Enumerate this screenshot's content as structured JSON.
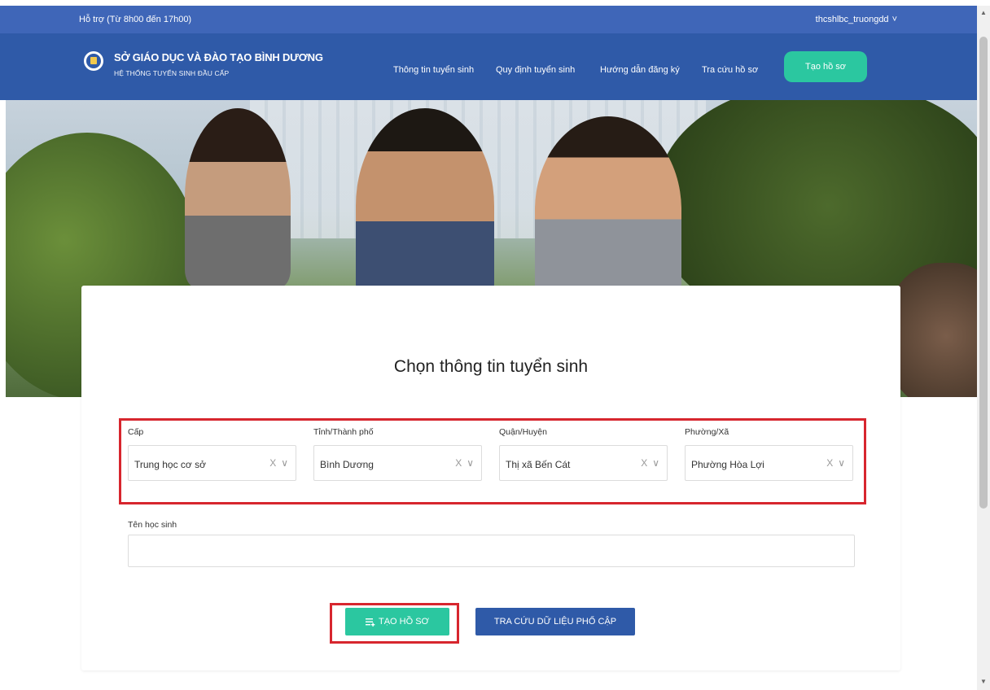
{
  "topbar": {
    "support": "Hỗ trợ (Từ 8h00 đến 17h00)",
    "user": "thcshlbc_truongdd",
    "user_chevron": "˅"
  },
  "header": {
    "brand_title": "SỞ GIÁO DỤC VÀ ĐÀO TẠO BÌNH DƯƠNG",
    "brand_sub": "HỆ THỐNG TUYỂN SINH ĐẦU CẤP",
    "nav": [
      "Thông tin tuyển sinh",
      "Quy định tuyển sinh",
      "Hướng dẫn đăng ký",
      "Tra cứu hồ sơ"
    ],
    "cta": "Tạo hồ sơ"
  },
  "form": {
    "title": "Chọn thông tin tuyển sinh",
    "filters": [
      {
        "label": "Cấp",
        "value": "Trung học cơ sở"
      },
      {
        "label": "Tỉnh/Thành phố",
        "value": "Bình Dương"
      },
      {
        "label": "Quận/Huyện",
        "value": "Thị xã Bến Cát"
      },
      {
        "label": "Phường/Xã",
        "value": "Phường Hòa Lợi"
      }
    ],
    "clear_symbol": "X",
    "chevron_symbol": "∨",
    "student_name_label": "Tên học sinh",
    "student_name_value": "",
    "create_button": "TẠO HỒ SƠ",
    "lookup_button": "TRA CỨU DỮ LIỆU PHỔ CẬP"
  },
  "colors": {
    "primary": "#2f5aa8",
    "topbar": "#3f66b8",
    "accent": "#2bc7a0",
    "highlight": "#d7262e"
  },
  "icons": {
    "logo": "ministry-logo-icon",
    "create": "list-plus-icon"
  }
}
